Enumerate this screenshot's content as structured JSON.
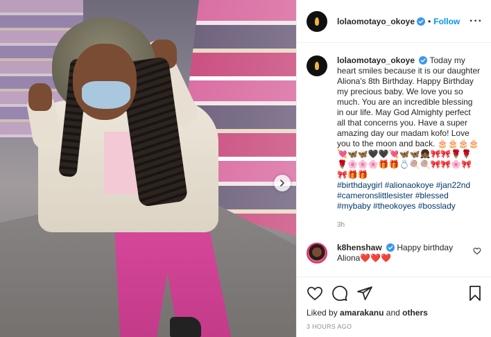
{
  "post": {
    "author": "lolaomotayo_okoye",
    "follow_label": "Follow",
    "more_label": "···",
    "caption_text": "Today my heart smiles because it is our daughter Aliona's 8th Birthday. Happy Birthday my precious baby. We love you so much. You are an incredible blessing in our life. May God Almighty perfect all that concerns you. Have a super amazing day our madam kofo! Love you to the moon and back. 🎂🎂🎂🎂💘🦋🦋🖤🖤💘🦋🦋👧🏾🎀🎀🌹🌹🌹🌸🌸🌸🎁🎁💍🍭🍭🎀🎀🌸🎀🎀🎁🎁",
    "hashtags": "#birthdaygirl #alionaokoye #jan22nd #cameronslittlesister #blessed #mybaby #theokoyes #bosslady",
    "time_ago": "3h"
  },
  "comment": {
    "user": "k8henshaw",
    "text": "Happy birthday Aliona❤️❤️❤️"
  },
  "engagement": {
    "liked_prefix": "Liked by",
    "liked_user": "amarakanu",
    "liked_joiner": "and",
    "liked_others": "others",
    "timestamp": "3 HOURS AGO"
  },
  "icons": {
    "next": "chevron-right-icon",
    "like": "heart-icon",
    "comment": "comment-icon",
    "share": "paper-plane-icon",
    "save": "bookmark-icon",
    "verified": "verified-badge-icon"
  },
  "colors": {
    "accent": "#0095f6",
    "verified": "#3897f0",
    "muted": "#8e8e8e",
    "hashtag": "#00376b"
  }
}
